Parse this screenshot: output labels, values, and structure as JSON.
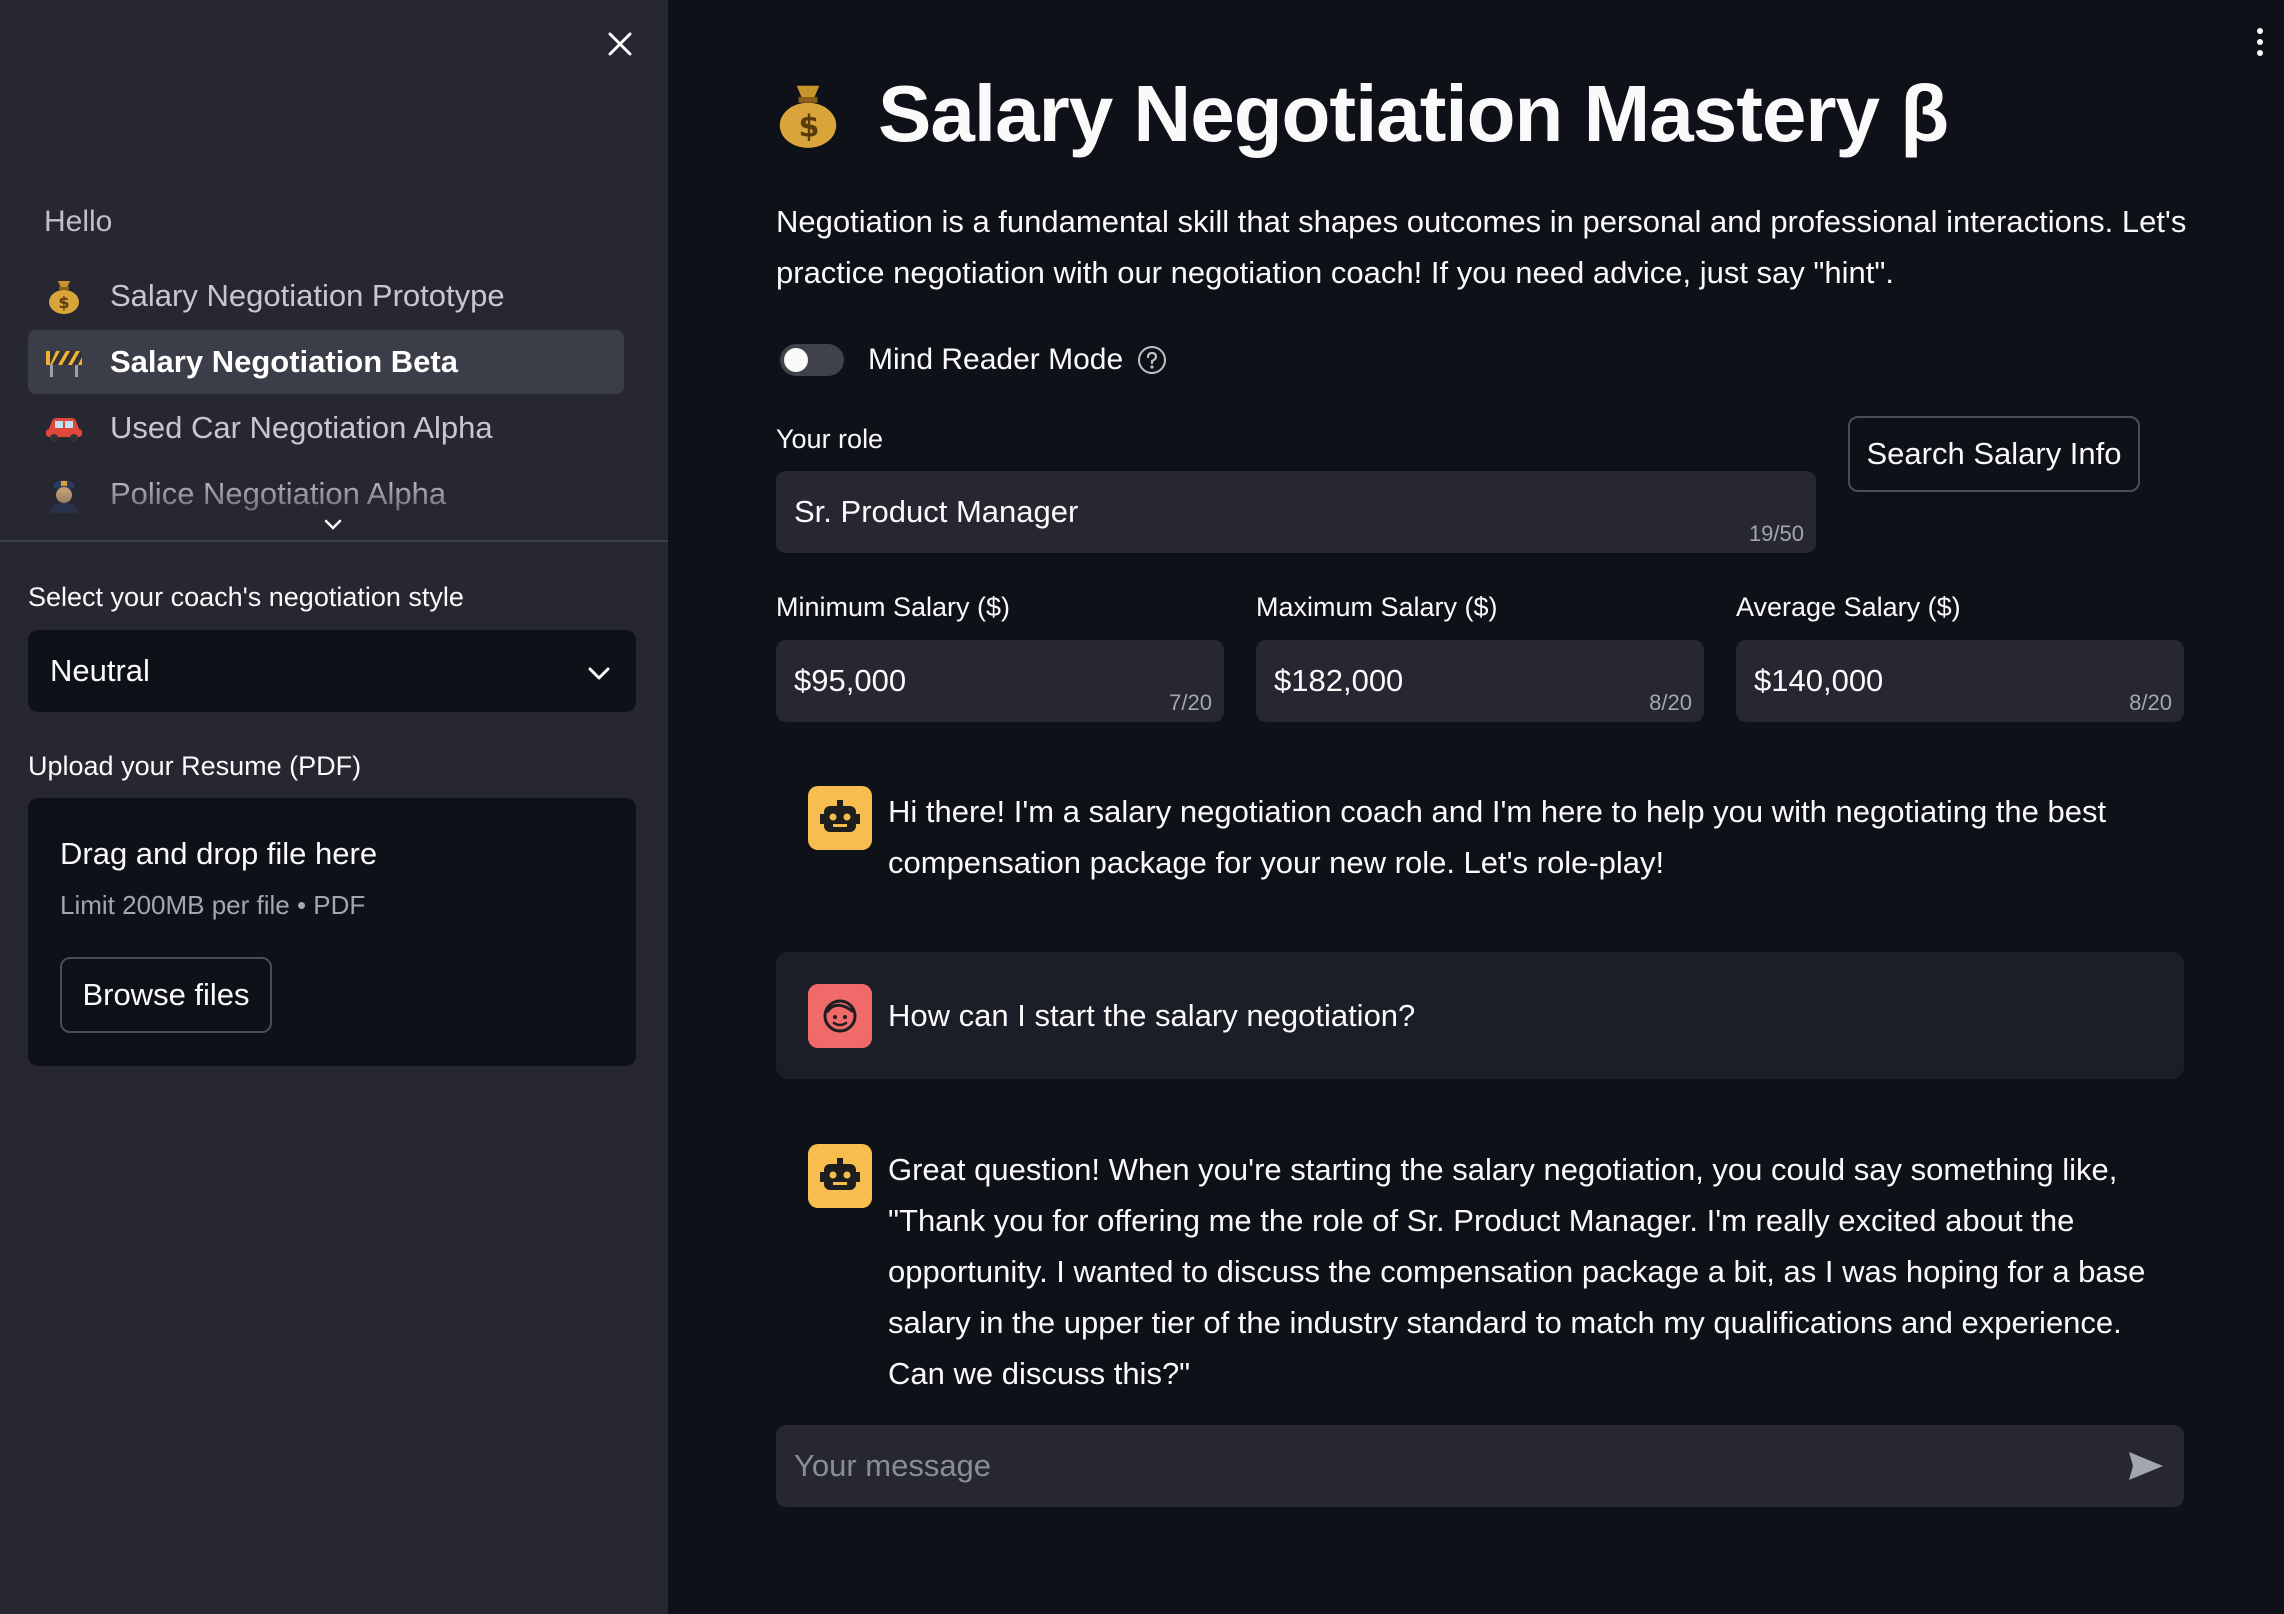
{
  "sidebar": {
    "close_icon": "close-icon",
    "nav_heading": "Hello",
    "nav_items": [
      {
        "label": "Salary Negotiation Prototype",
        "icon": "money-bag-icon",
        "active": false
      },
      {
        "label": "Salary Negotiation Beta",
        "icon": "construction-icon",
        "active": true
      },
      {
        "label": "Used Car Negotiation Alpha",
        "icon": "car-icon",
        "active": false
      },
      {
        "label": "Police Negotiation Alpha",
        "icon": "police-officer-icon",
        "active": false
      }
    ],
    "coach_style_label": "Select your coach's negotiation style",
    "coach_style_value": "Neutral",
    "upload_label": "Upload your Resume (PDF)",
    "upload_dnd_text": "Drag and drop file here",
    "upload_limit_text": "Limit 200MB per file • PDF",
    "browse_label": "Browse files"
  },
  "main": {
    "title": "Salary Negotiation Mastery β",
    "title_icon": "money-bag-icon",
    "intro": "Negotiation is a fundamental skill that shapes outcomes in personal and professional interactions. Let's practice negotiation with our negotiation coach! If you need advice, just say \"hint\".",
    "mind_reader_label": "Mind Reader Mode",
    "mind_reader_on": false,
    "role_label": "Your role",
    "role_value": "Sr. Product Manager",
    "role_count": "19/50",
    "search_button": "Search Salary Info",
    "salary_fields": [
      {
        "label": "Minimum Salary ($)",
        "value": "$95,000",
        "count": "7/20"
      },
      {
        "label": "Maximum Salary ($)",
        "value": "$182,000",
        "count": "8/20"
      },
      {
        "label": "Average Salary ($)",
        "value": "$140,000",
        "count": "8/20"
      }
    ],
    "messages": [
      {
        "role": "assistant",
        "text": "Hi there! I'm a salary negotiation coach and I'm here to help you with negotiating the best compensation package for your new role. Let's role-play!"
      },
      {
        "role": "user",
        "text": "How can I start the salary negotiation?"
      },
      {
        "role": "assistant",
        "text": "Great question! When you're starting the salary negotiation, you could say something like, \"Thank you for offering me the role of Sr. Product Manager. I'm really excited about the opportunity. I wanted to discuss the compensation package a bit, as I was hoping for a base salary in the upper tier of the industry standard to match my qualifications and experience. Can we discuss this?\""
      }
    ],
    "chat_placeholder": "Your message",
    "colors": {
      "background": "#0e1117",
      "sidebar": "#262730",
      "bot_avatar": "#f8bd4f",
      "user_avatar": "#f06a6a"
    }
  }
}
